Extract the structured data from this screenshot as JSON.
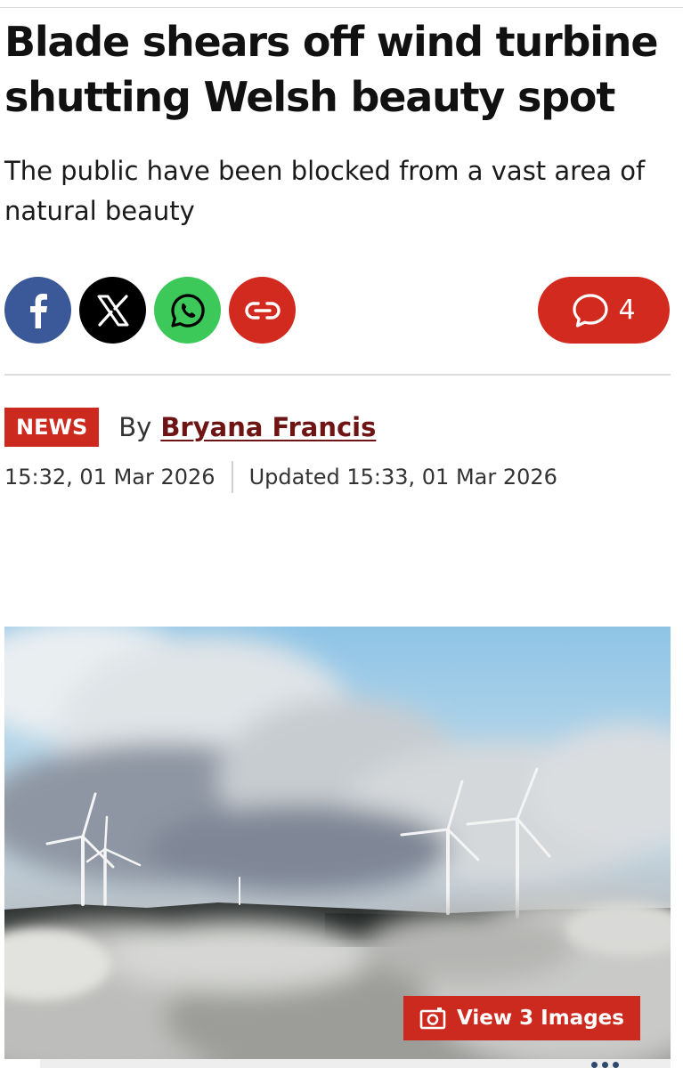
{
  "article": {
    "headline": "Blade shears off wind turbine shutting Welsh beauty spot",
    "subheadline": "The public have been blocked from a vast area of natural beauty"
  },
  "share": {
    "buttons": [
      {
        "icon": "facebook-icon",
        "color": "#3b5998"
      },
      {
        "icon": "x-icon",
        "color": "#000000"
      },
      {
        "icon": "whatsapp-icon",
        "color": "#3cc95a"
      },
      {
        "icon": "link-icon",
        "color": "#d32a20"
      }
    ],
    "comments_count": "4",
    "comments_icon": "speech-bubble-icon",
    "comments_color": "#d32a20"
  },
  "byline": {
    "section_badge": "NEWS",
    "by_label": "By",
    "author": "Bryana Francis",
    "published": "15:32, 01 Mar 2026",
    "updated": "Updated 15:33, 01 Mar 2026"
  },
  "hero_image": {
    "description_icon": "wind-turbines-in-fog-photo",
    "view_images_label": "View 3 Images",
    "view_images_icon": "camera-icon"
  },
  "colors": {
    "accent_red": "#cc2a1e",
    "author_link": "#6e1414"
  }
}
